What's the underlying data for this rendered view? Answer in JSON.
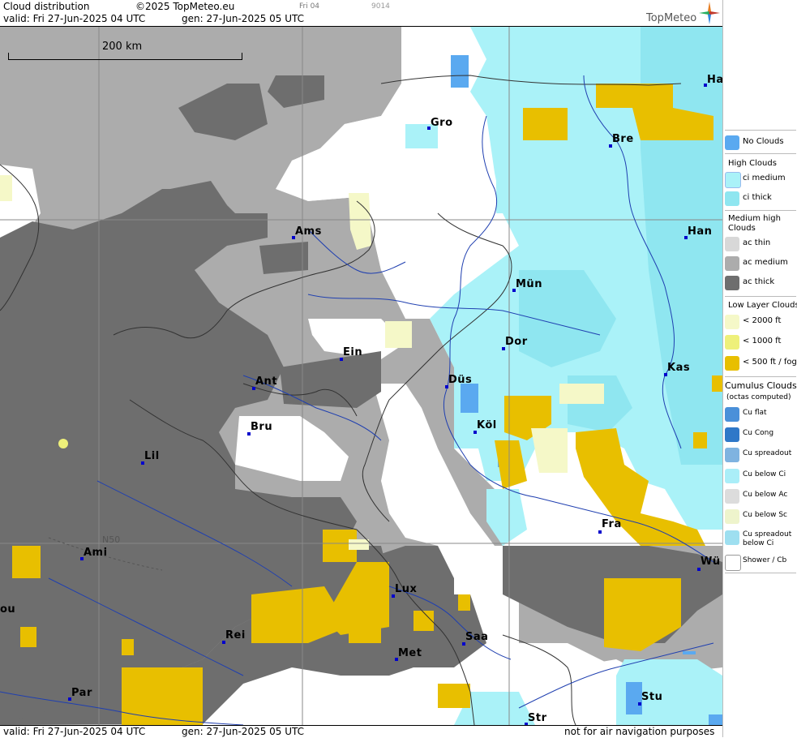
{
  "header": {
    "product": "Cloud distribution",
    "copyright": "©2025 TopMeteo.eu",
    "run_tag": "Fri 04",
    "code": "9014",
    "valid": "valid:  Fri  27-Jun-2025  04 UTC",
    "generated": "gen: 27-Jun-2025 05 UTC",
    "brand": "TopMeteo"
  },
  "footer": {
    "valid": "valid:  Fri  27-Jun-2025  04 UTC",
    "generated": "gen: 27-Jun-2025 05 UTC",
    "disclaimer": "not for air navigation purposes"
  },
  "map": {
    "scale_label": "200 km",
    "latitude_label": "N50",
    "cities": [
      "Ha",
      "Gro",
      "Bre",
      "Ams",
      "Han",
      "Mün",
      "Dor",
      "Ein",
      "Düs",
      "Kas",
      "Ant",
      "Köl",
      "Bru",
      "Lil",
      "Fra",
      "Ami",
      "Wü",
      "Lux",
      "Rei",
      "Saa",
      "Met",
      "Par",
      "Stu",
      "Str",
      "ou"
    ]
  },
  "legend": {
    "no_clouds": "No Clouds",
    "high_heading": "High Clouds",
    "ci_medium": "ci medium",
    "ci_thick": "ci thick",
    "medium_heading": "Medium high Clouds",
    "ac_thin": "ac thin",
    "ac_medium": "ac medium",
    "ac_thick": "ac thick",
    "low_heading": "Low Layer Clouds",
    "low_2000": "< 2000 ft",
    "low_1000": "< 1000 ft",
    "low_500": "< 500 ft / fog",
    "cumulus_heading": "Cumulus Clouds",
    "cumulus_sub": "(octas computed)",
    "cu_flat": "Cu flat",
    "cu_cong": "Cu Cong",
    "cu_spreadout": "Cu spreadout",
    "cu_below_ci": "Cu below Ci",
    "cu_below_ac": "Cu below Ac",
    "cu_below_sc": "Cu below Sc",
    "cu_spreadout_below_ci": "Cu spreadout below Ci",
    "shower_cb": "Shower / Cb"
  },
  "colors": {
    "no_clouds": "#5aa9f0",
    "ci_medium": "#aaf2f8",
    "ci_thick": "#8fe6f0",
    "ac_thin": "#d8d8d8",
    "ac_medium": "#acacac",
    "ac_thick": "#6e6e6e",
    "low_2000": "#f5f8c8",
    "low_1000": "#eef07a",
    "low_500": "#e8bf00",
    "river": "#1f3fb0",
    "border": "#333333",
    "grid": "#888888"
  }
}
